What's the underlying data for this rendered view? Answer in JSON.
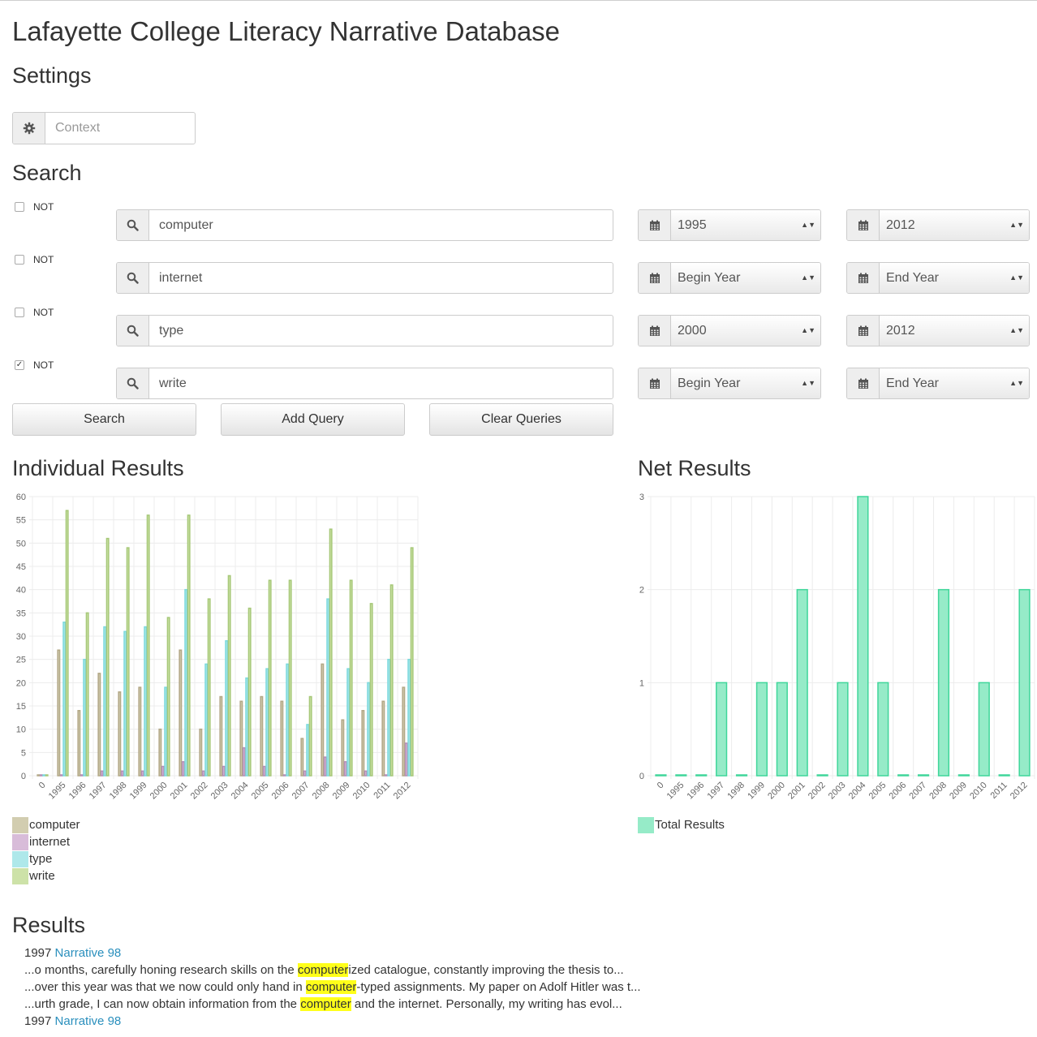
{
  "app_title": "Lafayette College Literacy Narrative Database",
  "settings": {
    "heading": "Settings",
    "context_placeholder": "Context"
  },
  "search": {
    "heading": "Search",
    "queries": [
      {
        "not_label": "NOT",
        "not_checked": false,
        "term": "computer",
        "begin_year": "1995",
        "end_year": "2012"
      },
      {
        "not_label": "NOT",
        "not_checked": false,
        "term": "internet",
        "begin_year": "Begin Year",
        "end_year": "End Year"
      },
      {
        "not_label": "NOT",
        "not_checked": false,
        "term": "type",
        "begin_year": "2000",
        "end_year": "2012"
      },
      {
        "not_label": "NOT",
        "not_checked": true,
        "term": "write",
        "begin_year": "Begin Year",
        "end_year": "End Year"
      }
    ],
    "buttons": {
      "search": "Search",
      "add_query": "Add Query",
      "clear_queries": "Clear Queries"
    }
  },
  "individual_results": {
    "heading": "Individual Results"
  },
  "net_results": {
    "heading": "Net Results"
  },
  "chart_data": [
    {
      "type": "bar",
      "categories": [
        "0",
        "1995",
        "1996",
        "1997",
        "1998",
        "1999",
        "2000",
        "2001",
        "2002",
        "2003",
        "2004",
        "2005",
        "2006",
        "2007",
        "2008",
        "2009",
        "2010",
        "2011",
        "2012"
      ],
      "ylim": [
        0,
        60
      ],
      "yticks": [
        0,
        5,
        10,
        15,
        20,
        25,
        30,
        35,
        40,
        45,
        50,
        55,
        60
      ],
      "legend_position": "bottom-left",
      "grid": true,
      "series": [
        {
          "name": "computer",
          "color": "#d2cdb0",
          "stroke": "#b3a886",
          "values": [
            0,
            27,
            14,
            22,
            18,
            19,
            10,
            27,
            10,
            17,
            16,
            17,
            16,
            8,
            24,
            12,
            14,
            16,
            19
          ]
        },
        {
          "name": "internet",
          "color": "#d8bcd9",
          "stroke": "#b48fb6",
          "values": [
            0,
            0,
            0,
            1,
            1,
            1,
            2,
            3,
            1,
            2,
            6,
            2,
            0,
            1,
            4,
            3,
            1,
            0,
            7
          ]
        },
        {
          "name": "type",
          "color": "#aee8ea",
          "stroke": "#7bd9dd",
          "values": [
            0,
            33,
            25,
            32,
            31,
            32,
            19,
            40,
            24,
            29,
            21,
            23,
            24,
            11,
            38,
            23,
            20,
            25,
            25
          ]
        },
        {
          "name": "write",
          "color": "#cde2a8",
          "stroke": "#a6c878",
          "values": [
            0,
            57,
            35,
            51,
            49,
            56,
            34,
            56,
            38,
            43,
            36,
            42,
            42,
            17,
            53,
            42,
            37,
            41,
            49
          ]
        }
      ]
    },
    {
      "type": "bar",
      "categories": [
        "0",
        "1995",
        "1996",
        "1997",
        "1998",
        "1999",
        "2000",
        "2001",
        "2002",
        "2003",
        "2004",
        "2005",
        "2006",
        "2007",
        "2008",
        "2009",
        "2010",
        "2011",
        "2012"
      ],
      "ylim": [
        0,
        3
      ],
      "yticks": [
        0,
        1,
        2,
        3
      ],
      "legend_position": "bottom-left",
      "grid": true,
      "series": [
        {
          "name": "Total Results",
          "color": "#96ebc8",
          "stroke": "#3fd69a",
          "values": [
            0,
            0,
            0,
            1,
            0,
            1,
            1,
            2,
            0,
            1,
            3,
            1,
            0,
            0,
            2,
            0,
            1,
            0,
            2
          ]
        }
      ]
    }
  ],
  "results": {
    "heading": "Results",
    "entries": [
      {
        "year": "1997",
        "link": "Narrative 98"
      },
      {
        "year": "1997",
        "link": "Narrative 98"
      }
    ],
    "snippets": [
      {
        "pre": "...o months, carefully honing research skills on the ",
        "match": "computer",
        "post": "ized catalogue, constantly improving the thesis to..."
      },
      {
        "pre": "...over this year was that we now could only hand in ",
        "match": "computer",
        "post": "-typed assignments. My paper on Adolf Hitler was t..."
      },
      {
        "pre": "...urth grade, I can now obtain information from the ",
        "match": "computer",
        "post": " and the internet. Personally, my writing has evol..."
      }
    ]
  }
}
